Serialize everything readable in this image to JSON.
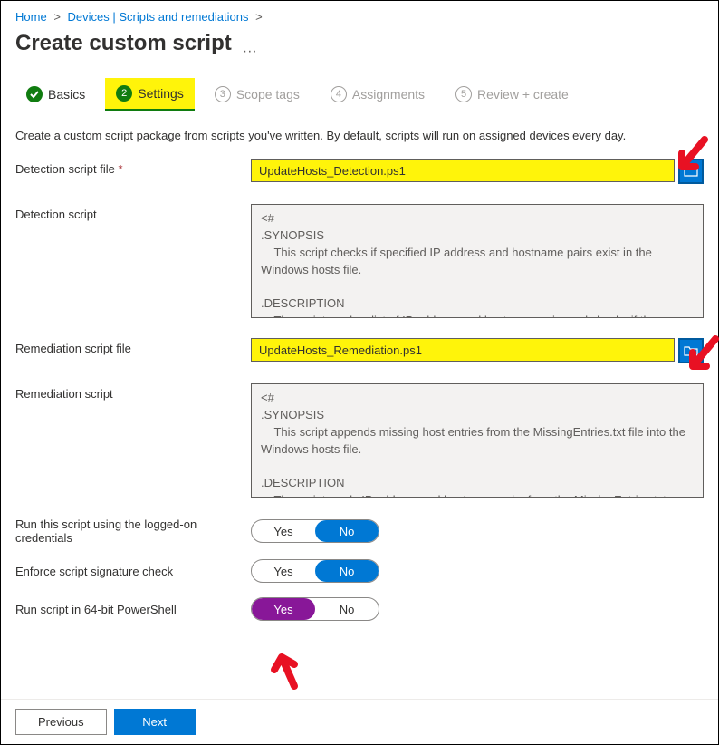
{
  "breadcrumb": {
    "home": "Home",
    "devices": "Devices | Scripts and remediations"
  },
  "page_title": "Create custom script",
  "tabs": {
    "basics": "Basics",
    "settings": "Settings",
    "scope": "Scope tags",
    "assignments": "Assignments",
    "review": "Review + create",
    "num1": "",
    "num2": "2",
    "num3": "3",
    "num4": "4",
    "num5": "5"
  },
  "description": "Create a custom script package from scripts you've written. By default, scripts will run on assigned devices every day.",
  "labels": {
    "detection_file": "Detection script file",
    "detection_script": "Detection script",
    "remediation_file": "Remediation script file",
    "remediation_script": "Remediation script",
    "run_logged": "Run this script using the logged-on credentials",
    "enforce_sig": "Enforce script signature check",
    "run_64": "Run script in 64-bit PowerShell",
    "required": "*"
  },
  "values": {
    "detection_file": "UpdateHosts_Detection.ps1",
    "remediation_file": "UpdateHosts_Remediation.ps1",
    "detection_script": "<#\n.SYNOPSIS\n    This script checks if specified IP address and hostname pairs exist in the Windows hosts file.\n\n.DESCRIPTION\n    The script reads a list of IP address and hostname pairs and checks if they",
    "remediation_script": "<#\n.SYNOPSIS\n    This script appends missing host entries from the MissingEntries.txt file into the Windows hosts file.\n\n.DESCRIPTION\n    The script reads IP address and hostname pairs from the MissingEntries.txt"
  },
  "toggle": {
    "yes": "Yes",
    "no": "No"
  },
  "buttons": {
    "previous": "Previous",
    "next": "Next"
  }
}
